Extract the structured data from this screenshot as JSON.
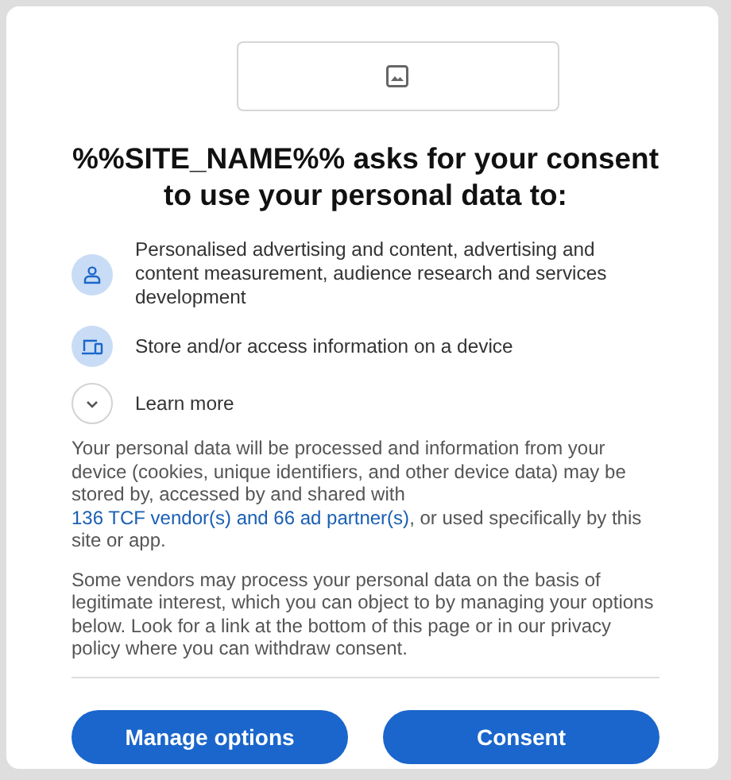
{
  "title": "%%SITE_NAME%% asks for your consent to use your personal data to:",
  "purposes": [
    {
      "kind": "person",
      "text": "Personalised advertising and content, advertising and content measurement, audience research and services development"
    },
    {
      "kind": "device",
      "text": "Store and/or access information on a device"
    }
  ],
  "learn_more": {
    "label": "Learn more",
    "expanded": false
  },
  "paragraphs": [
    {
      "parts": [
        {
          "kind": "text",
          "text": "Your personal data will be processed and information from your device (cookies, unique identifiers, and other device data) may be stored by, accessed by and shared with "
        },
        {
          "kind": "link",
          "text": "136 TCF vendor(s) and 66 ad partner(s)"
        },
        {
          "kind": "text",
          "text": ", or used specifically by this site or app."
        }
      ]
    },
    {
      "parts": [
        {
          "kind": "text",
          "text": "Some vendors may process your personal data on the basis of legitimate interest, which you can object to by managing your options below. Look for a link at the bottom of this page or in our privacy policy where you can withdraw consent."
        }
      ]
    }
  ],
  "buttons": [
    "Manage options",
    "Consent"
  ]
}
